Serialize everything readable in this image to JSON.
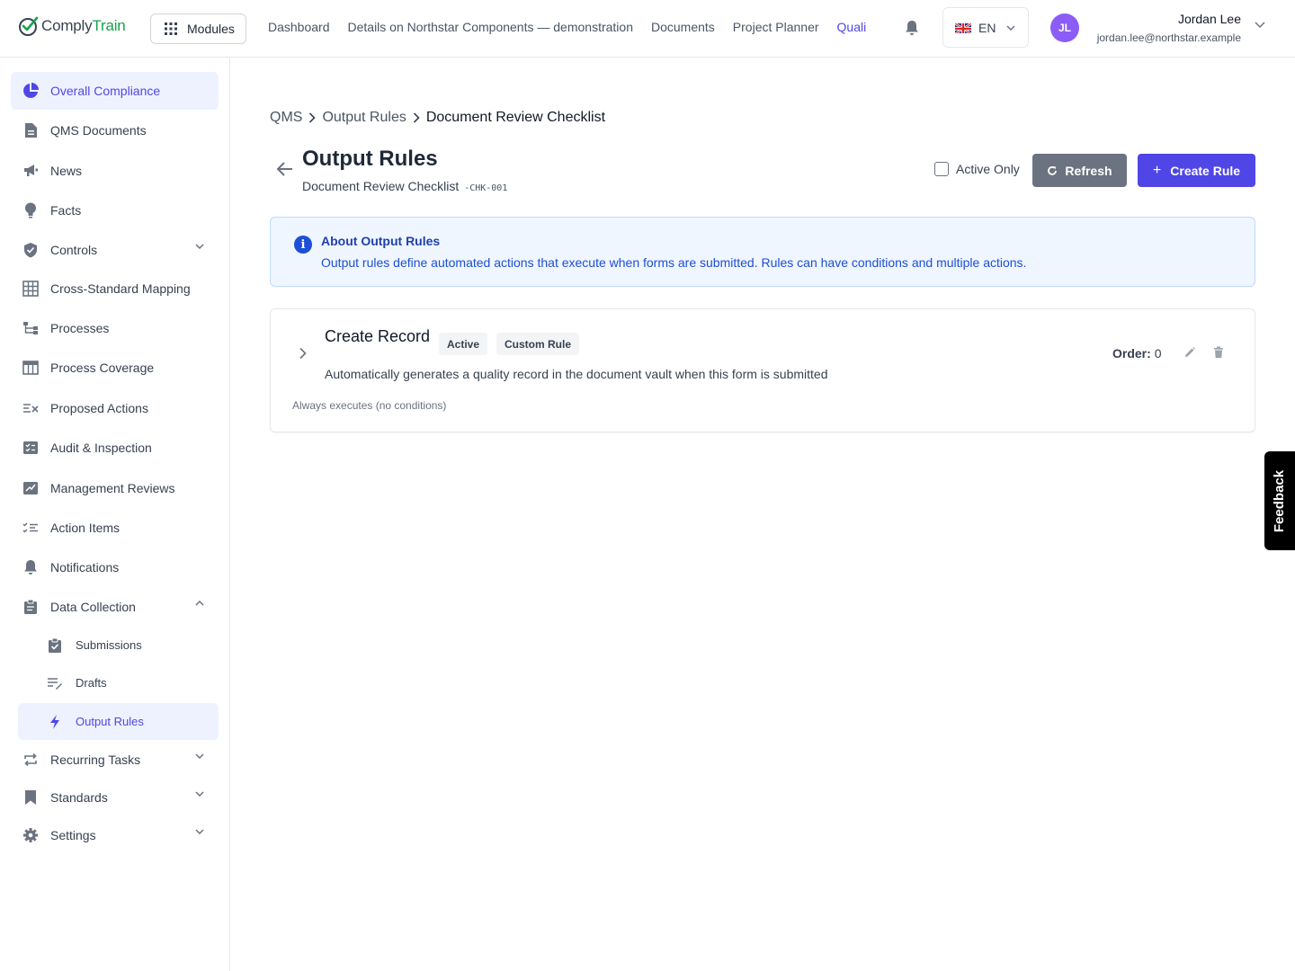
{
  "app": {
    "brand_part1": "Comply",
    "brand_part2": "Train",
    "modules_label": "Modules"
  },
  "topnav": {
    "items": [
      "Dashboard",
      "Details on Northstar Components — demonstration",
      "Documents",
      "Project Planner"
    ],
    "active_item": "Quali"
  },
  "language": {
    "code": "EN",
    "flag_icon": "uk-flag-icon"
  },
  "user": {
    "initials": "JL",
    "name": "Jordan Lee",
    "email": "jordan.lee@northstar.example",
    "avatar_color": "#8b5cf6"
  },
  "sidebar": {
    "items": [
      {
        "label": "Overall Compliance",
        "icon": "pie-chart-icon",
        "active": true
      },
      {
        "label": "QMS Documents",
        "icon": "document-icon"
      },
      {
        "label": "News",
        "icon": "megaphone-icon"
      },
      {
        "label": "Facts",
        "icon": "lightbulb-icon"
      },
      {
        "label": "Controls",
        "icon": "shield-icon",
        "expandable": true
      },
      {
        "label": "Cross-Standard Mapping",
        "icon": "grid-icon"
      },
      {
        "label": "Processes",
        "icon": "flow-icon"
      },
      {
        "label": "Process Coverage",
        "icon": "table-icon"
      },
      {
        "label": "Proposed Actions",
        "icon": "list-x-icon"
      },
      {
        "label": "Audit & Inspection",
        "icon": "checklist-icon"
      },
      {
        "label": "Management Reviews",
        "icon": "review-icon"
      },
      {
        "label": "Action Items",
        "icon": "checklist-icon"
      },
      {
        "label": "Notifications",
        "icon": "bell-icon"
      },
      {
        "label": "Data Collection",
        "icon": "clipboard-icon",
        "expanded": true
      },
      {
        "label": "Recurring Tasks",
        "icon": "repeat-icon",
        "expandable": true
      },
      {
        "label": "Standards",
        "icon": "bookmark-icon",
        "expandable": true
      },
      {
        "label": "Settings",
        "icon": "gear-icon",
        "expandable": true
      }
    ],
    "sub_items": [
      {
        "label": "Submissions",
        "icon": "clipboard-check-icon"
      },
      {
        "label": "Drafts",
        "icon": "draft-icon"
      },
      {
        "label": "Output Rules",
        "icon": "bolt-icon",
        "active": true
      }
    ]
  },
  "breadcrumb": [
    "QMS",
    "Output Rules",
    "Document Review Checklist"
  ],
  "page": {
    "title": "Output Rules",
    "subtitle": "Document Review Checklist",
    "code": "-CHK-001",
    "active_only_label": "Active Only",
    "active_only_checked": false,
    "refresh_label": "Refresh",
    "create_label": "Create Rule"
  },
  "info": {
    "title": "About Output Rules",
    "text": "Output rules define automated actions that execute when forms are submitted. Rules can have conditions and multiple actions."
  },
  "rules": [
    {
      "title": "Create Record",
      "status_badge": "Active",
      "type_badge": "Custom Rule",
      "description": "Automatically generates a quality record in the document vault when this form is submitted",
      "condition": "Always executes (no conditions)",
      "order_label": "Order:",
      "order_value": "0"
    }
  ],
  "feedback_label": "Feedback",
  "colors": {
    "accent": "#4f46e5",
    "active_bg": "#eef2ff",
    "info_bg": "#eff6ff",
    "info_text": "#1d4ed8",
    "refresh_bg": "#6b7280",
    "brand_green": "#16a34a"
  }
}
